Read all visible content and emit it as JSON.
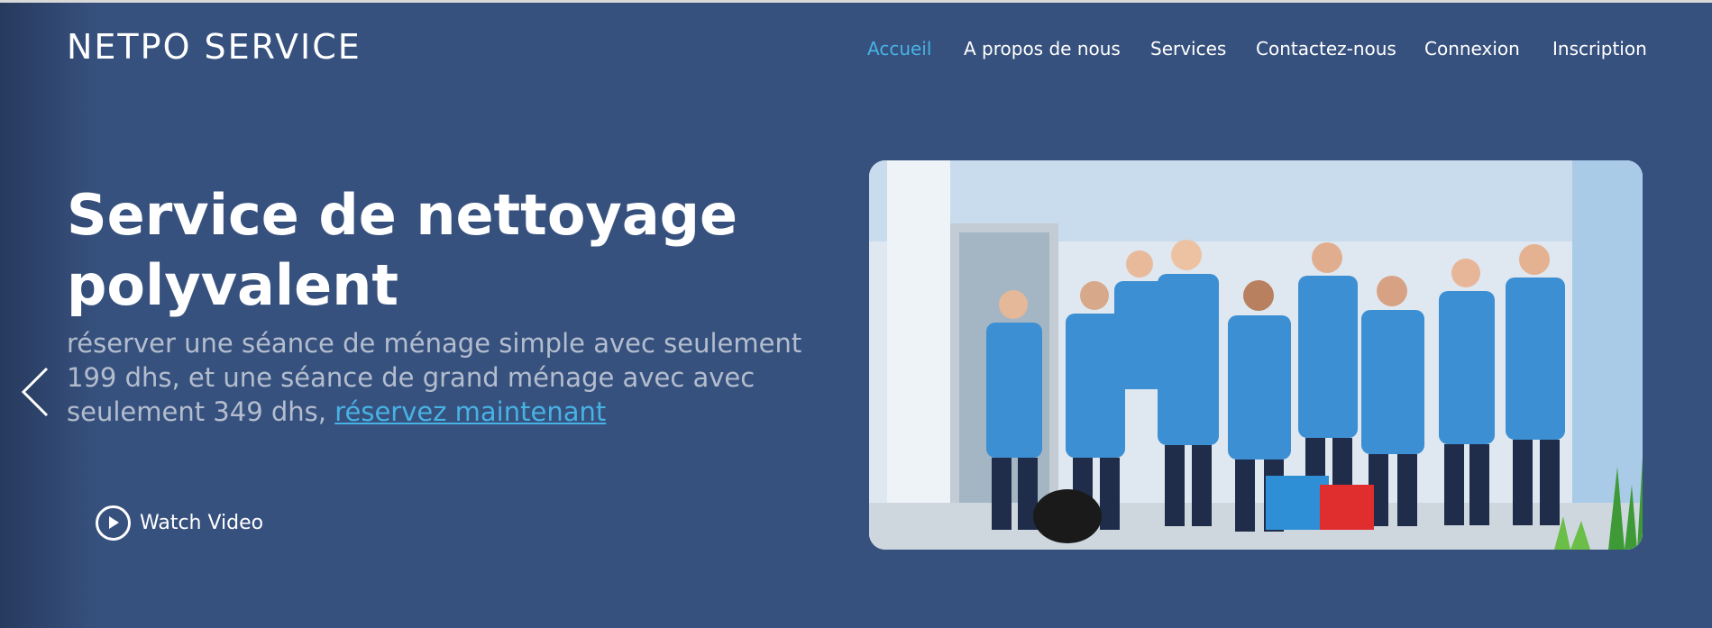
{
  "brand": {
    "logo_text": "NETPO SERVICE"
  },
  "nav": {
    "items": [
      {
        "label": "Accueil",
        "active": true
      },
      {
        "label": "A propos de nous",
        "active": false
      },
      {
        "label": "Services",
        "active": false
      },
      {
        "label": "Contactez-nous",
        "active": false
      },
      {
        "label": "Connexion",
        "active": false
      },
      {
        "label": "Inscription",
        "active": false
      }
    ]
  },
  "hero": {
    "title_line1": "Service de nettoyage",
    "title_line2": "polyvalent",
    "description": "réserver une séance de ménage simple avec seulement 199 dhs, et une séance de grand ménage avec avec seulement 349 dhs, ",
    "cta_link": "réservez maintenant",
    "watch_video_label": "Watch Video",
    "image_icon": "cleaning-team-photo"
  },
  "carousel": {
    "prev_icon": "chevron-left-icon"
  },
  "colors": {
    "background": "#37517e",
    "accent": "#47b2e4",
    "text": "#ffffff",
    "muted_text": "rgba(255,255,255,0.62)",
    "apron_blue": "#3d8fd3"
  }
}
